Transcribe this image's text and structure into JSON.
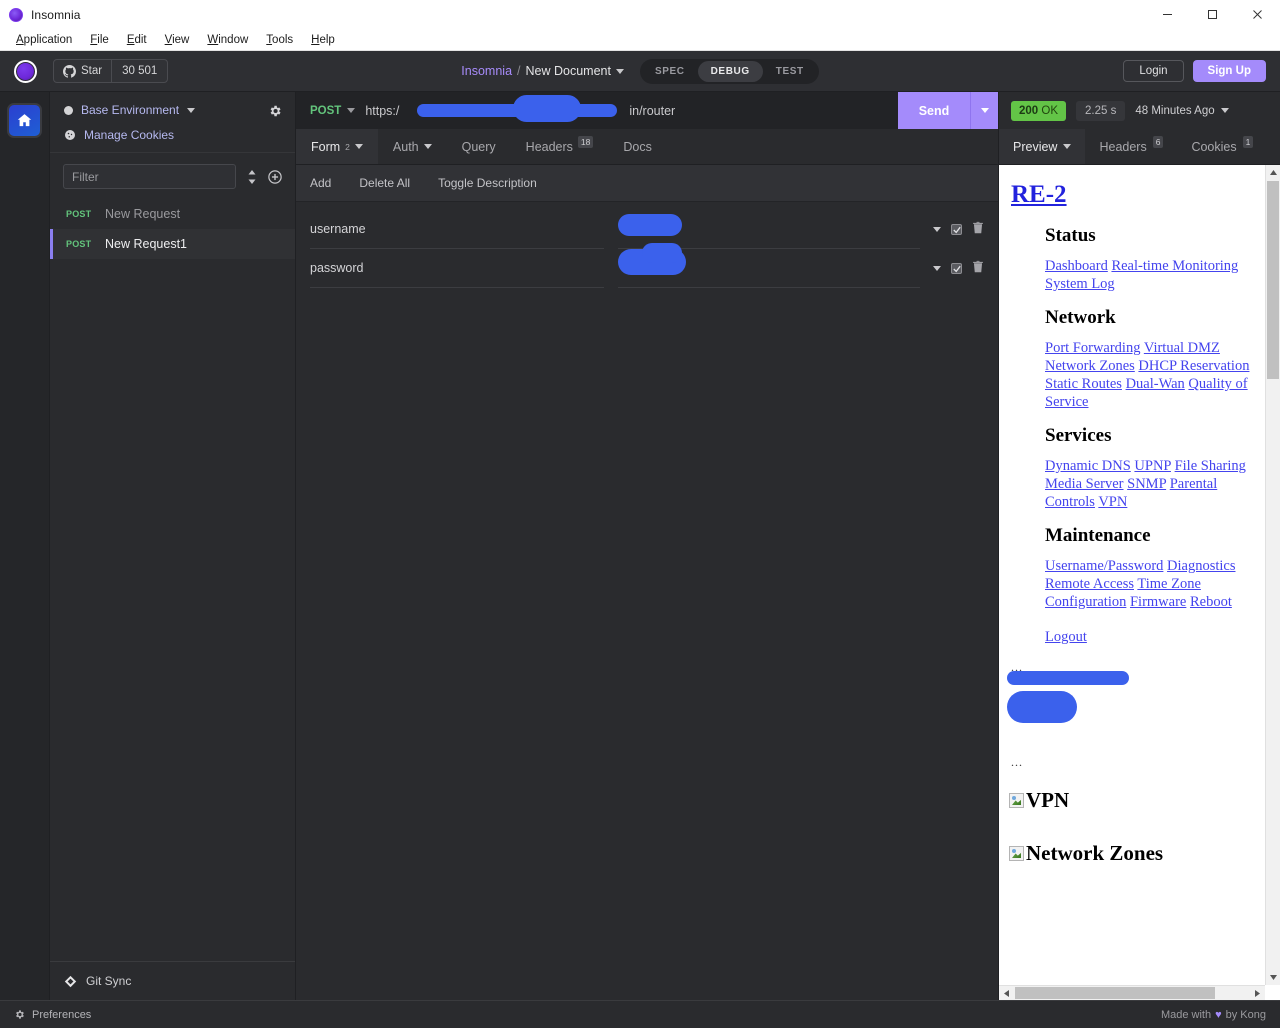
{
  "window": {
    "title": "Insomnia",
    "controls": {
      "minimize": "minimize-icon",
      "maximize": "maximize-icon",
      "close": "close-icon"
    }
  },
  "menubar": [
    {
      "label": "Application",
      "accel": "A"
    },
    {
      "label": "File",
      "accel": "F"
    },
    {
      "label": "Edit",
      "accel": "E"
    },
    {
      "label": "View",
      "accel": "V"
    },
    {
      "label": "Window",
      "accel": "W"
    },
    {
      "label": "Tools",
      "accel": "T"
    },
    {
      "label": "Help",
      "accel": "H"
    }
  ],
  "topbar": {
    "star_label": "Star",
    "star_count": "30 501",
    "breadcrumb_app": "Insomnia",
    "breadcrumb_sep": "/",
    "breadcrumb_doc": "New Document",
    "modes": [
      {
        "label": "SPEC",
        "active": false
      },
      {
        "label": "DEBUG",
        "active": true
      },
      {
        "label": "TEST",
        "active": false
      }
    ],
    "login_label": "Login",
    "signup_label": "Sign Up",
    "accent_color": "#a48bfb"
  },
  "sidebar": {
    "environment": "Base Environment",
    "cookies": "Manage Cookies",
    "filter_placeholder": "Filter",
    "requests": [
      {
        "method": "POST",
        "name": "New Request",
        "active": false
      },
      {
        "method": "POST",
        "name": "New Request1",
        "active": true
      }
    ],
    "git_sync": "Git Sync"
  },
  "request": {
    "method": "POST",
    "url_prefix": "https:/",
    "url_suffix": "in/router",
    "send_label": "Send",
    "tabs": [
      {
        "label": "Form",
        "sup": "2",
        "badge": null,
        "caret": true,
        "active": true
      },
      {
        "label": "Auth",
        "sup": null,
        "badge": null,
        "caret": true,
        "active": false
      },
      {
        "label": "Query",
        "sup": null,
        "badge": null,
        "caret": false,
        "active": false
      },
      {
        "label": "Headers",
        "sup": null,
        "badge": "18",
        "caret": false,
        "active": false
      },
      {
        "label": "Docs",
        "sup": null,
        "badge": null,
        "caret": false,
        "active": false
      }
    ],
    "actions": [
      "Add",
      "Delete All",
      "Toggle Description"
    ],
    "form_rows": [
      {
        "key": "username",
        "value": "",
        "enabled": true
      },
      {
        "key": "password",
        "value": "",
        "enabled": true
      }
    ]
  },
  "response": {
    "status_code": "200",
    "status_text": "OK",
    "status_color": "#63c447",
    "time": "2.25 s",
    "age": "48 Minutes Ago",
    "tabs": [
      {
        "label": "Preview",
        "badge": null,
        "caret": true,
        "active": true
      },
      {
        "label": "Headers",
        "badge": "6",
        "caret": false,
        "active": false
      },
      {
        "label": "Cookies",
        "badge": "1",
        "caret": false,
        "active": false
      }
    ],
    "preview": {
      "title": "RE-2",
      "sections": [
        {
          "heading": "Status",
          "links": [
            "Dashboard",
            "Real-time Monitoring",
            "System Log"
          ]
        },
        {
          "heading": "Network",
          "links": [
            "Port Forwarding",
            "Virtual DMZ",
            "Network Zones",
            "DHCP Reservation",
            "Static Routes",
            "Dual-Wan",
            "Quality of Service"
          ]
        },
        {
          "heading": "Services",
          "links": [
            "Dynamic DNS",
            "UPNP",
            "File Sharing",
            "Media Server",
            "SNMP",
            "Parental Controls",
            "VPN"
          ]
        },
        {
          "heading": "Maintenance",
          "links": [
            "Username/Password",
            "Diagnostics",
            "Remote Access",
            "Time Zone",
            "Configuration",
            "Firmware",
            "Reboot"
          ]
        }
      ],
      "logout": "Logout",
      "ellipsis": "...",
      "broken_images": [
        "VPN",
        "Network Zones"
      ]
    }
  },
  "footer": {
    "preferences": "Preferences",
    "made_with_pre": "Made with",
    "made_with_post": "by Kong",
    "heart": "♥"
  }
}
